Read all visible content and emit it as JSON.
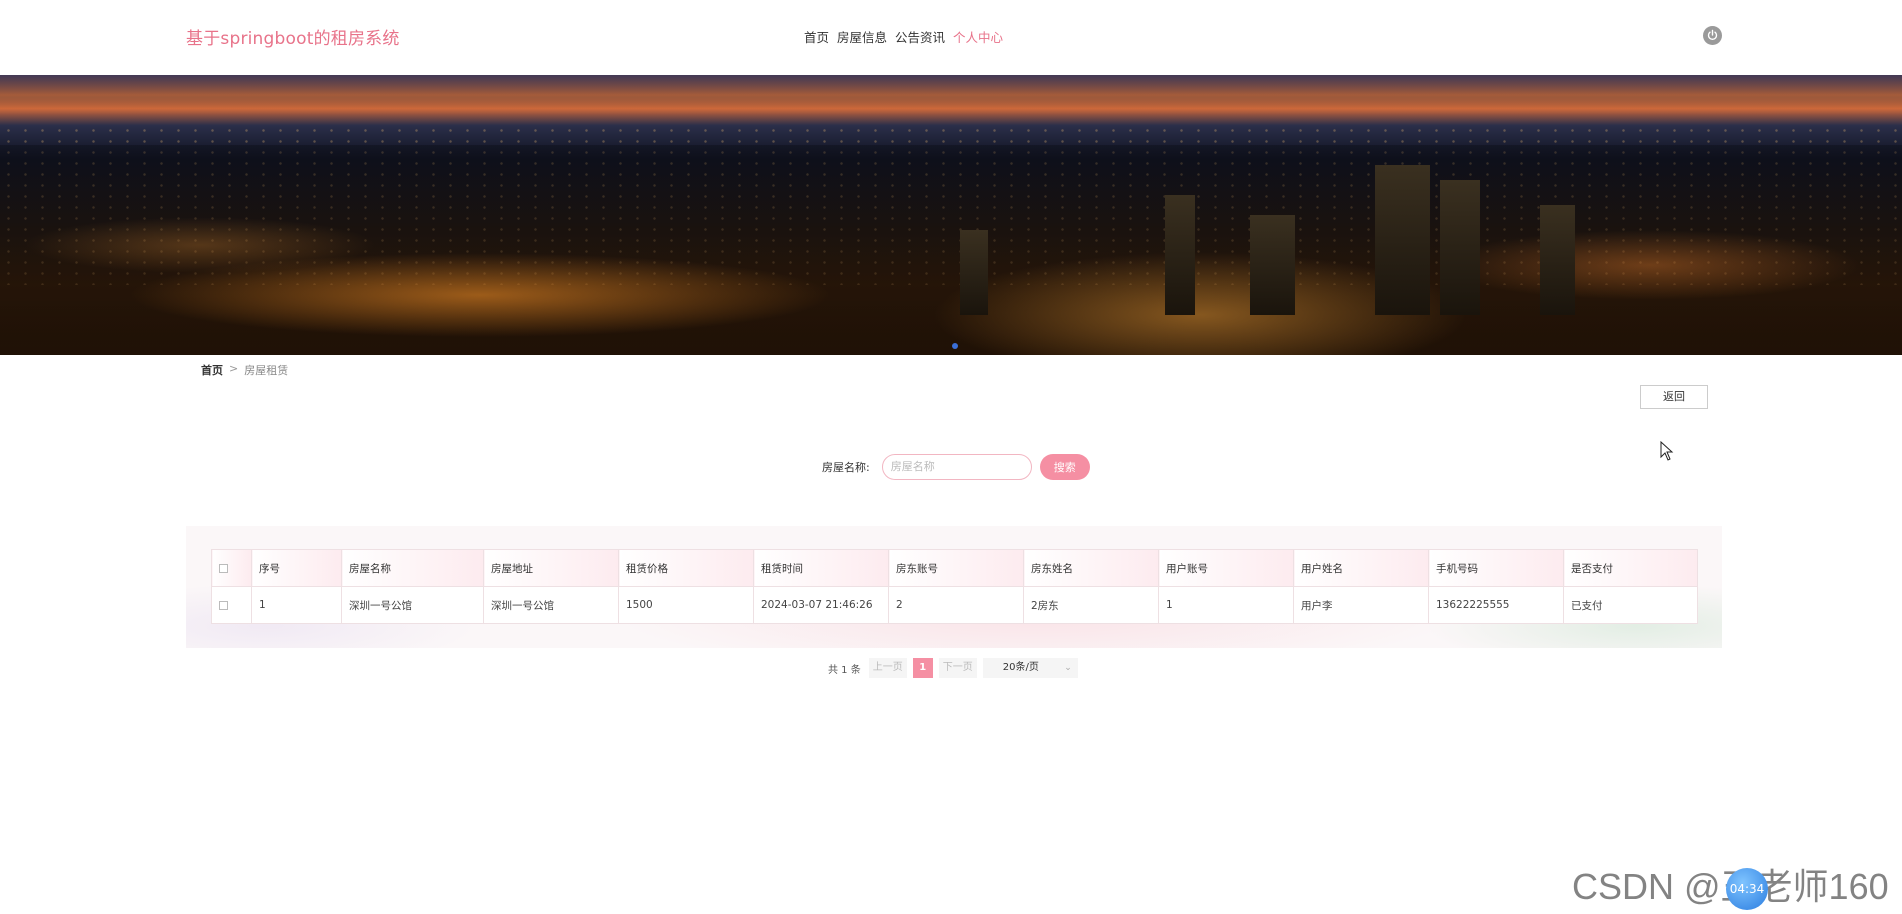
{
  "header": {
    "brand": "基于springboot的租房系统",
    "nav": [
      {
        "label": "首页",
        "active": false
      },
      {
        "label": "房屋信息",
        "active": false
      },
      {
        "label": "公告资讯",
        "active": false
      },
      {
        "label": "个人中心",
        "active": true
      }
    ],
    "power_icon": "power-icon"
  },
  "colors": {
    "accent": "#f58fa3",
    "brand": "#e8738a"
  },
  "breadcrumb": {
    "home": "首页",
    "separator": ">",
    "current": "房屋租赁"
  },
  "back_label": "返回",
  "search": {
    "label": "房屋名称:",
    "placeholder": "房屋名称",
    "button": "搜索"
  },
  "table": {
    "columns": [
      "序号",
      "房屋名称",
      "房屋地址",
      "租赁价格",
      "租赁时间",
      "房东账号",
      "房东姓名",
      "用户账号",
      "用户姓名",
      "手机号码",
      "是否支付"
    ],
    "rows": [
      [
        "1",
        "深圳一号公馆",
        "深圳一号公馆",
        "1500",
        "2024-03-07 21:46:26",
        "2",
        "2房东",
        "1",
        "用户李",
        "13622225555",
        "已支付"
      ]
    ]
  },
  "pagination": {
    "total": "共 1 条",
    "prev": "上一页",
    "current_page": "1",
    "next": "下一页",
    "page_size": "20条/页"
  },
  "watermark": "CSDN @王老师160",
  "timer": "04:34"
}
